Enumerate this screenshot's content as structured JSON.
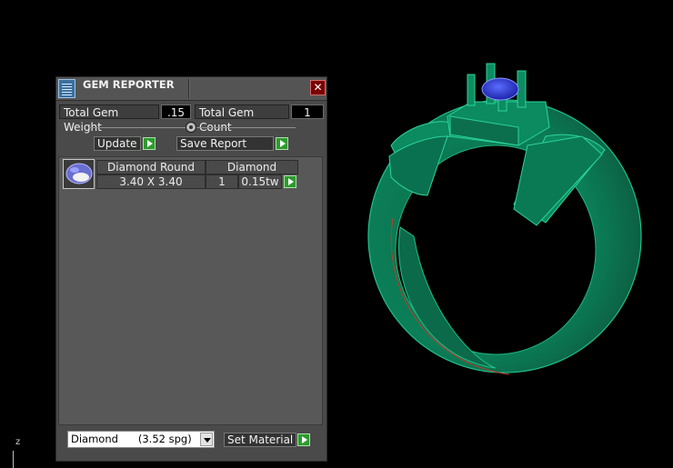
{
  "window": {
    "title": "GEM REPORTER",
    "close_symbol": "✕"
  },
  "summary": {
    "total_weight_label": "Total Gem Weight",
    "total_weight_value": ".15",
    "total_count_label": "Total Gem Count",
    "total_count_value": "1"
  },
  "toolbar": {
    "update_label": "Update",
    "save_report_label": "Save Report"
  },
  "gem_list": [
    {
      "thumbnail_icon": "round-gem-icon",
      "shape": "Diamond Round",
      "material": "Diamond",
      "size": "3.40 X 3.40",
      "count": "1",
      "weight": "0.15tw"
    }
  ],
  "material_picker": {
    "selected": "Diamond      (3.52 spg)",
    "set_material_label": "Set Material"
  },
  "viewport": {
    "axis_label": "z",
    "colors": {
      "ring": "#0b7a55",
      "ring_edges": "#20c08a",
      "stone": "#2a39d8",
      "background": "#000000"
    }
  }
}
